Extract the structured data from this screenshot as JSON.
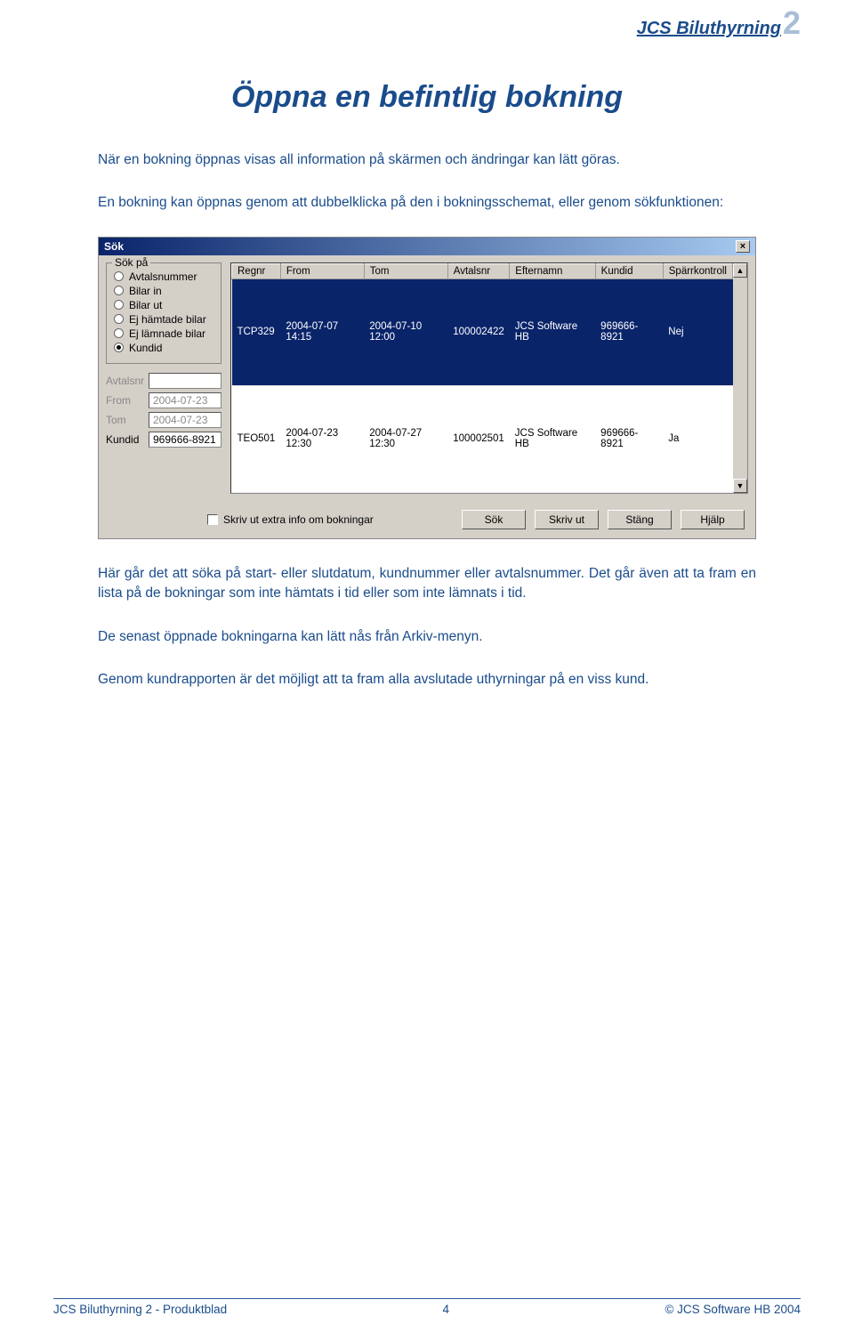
{
  "logo": {
    "text": "JCS Biluthyrning",
    "num": "2"
  },
  "title": "Öppna en befintlig bokning",
  "para1": "När en bokning öppnas visas all information på skärmen och ändringar kan lätt göras.",
  "para2": "En bokning kan öppnas genom att dubbelklicka på den i bokningsschemat, eller genom sökfunktionen:",
  "para3": "Här går det att söka på start- eller slutdatum, kundnummer eller avtalsnummer. Det går även att ta fram en lista på de bokningar som inte hämtats i tid eller som inte lämnats i tid.",
  "para4": "De senast öppnade bokningarna kan lätt nås från Arkiv-menyn.",
  "para5": "Genom kundrapporten är det möjligt att ta fram alla avslutade uthyrningar på en viss kund.",
  "window": {
    "title": "Sök",
    "close": "×",
    "group_label": "Sök på",
    "radios": [
      {
        "label": "Avtalsnummer",
        "checked": false
      },
      {
        "label": "Bilar in",
        "checked": false
      },
      {
        "label": "Bilar ut",
        "checked": false
      },
      {
        "label": "Ej hämtade bilar",
        "checked": false
      },
      {
        "label": "Ej lämnade bilar",
        "checked": false
      },
      {
        "label": "Kundid",
        "checked": true
      }
    ],
    "fields": {
      "avtalsnr": {
        "label": "Avtalsnr",
        "value": ""
      },
      "from": {
        "label": "From",
        "value": "2004-07-23"
      },
      "tom": {
        "label": "Tom",
        "value": "2004-07-23"
      },
      "kundid": {
        "label": "Kundid",
        "value": "969666-8921"
      }
    },
    "columns": [
      "Regnr",
      "From",
      "Tom",
      "Avtalsnr",
      "Efternamn",
      "Kundid",
      "Spärrkontroll"
    ],
    "rows": [
      {
        "cells": [
          "TCP329",
          "2004-07-07 14:15",
          "2004-07-10 12:00",
          "100002422",
          "JCS Software HB",
          "969666-8921",
          "Nej"
        ],
        "selected": true
      },
      {
        "cells": [
          "TEO501",
          "2004-07-23 12:30",
          "2004-07-27 12:30",
          "100002501",
          "JCS Software HB",
          "969666-8921",
          "Ja"
        ],
        "selected": false
      }
    ],
    "scrollbar": {
      "up": "▲",
      "down": "▼"
    },
    "checkbox_label": "Skriv ut extra info om bokningar",
    "buttons": [
      "Sök",
      "Skriv ut",
      "Stäng",
      "Hjälp"
    ]
  },
  "footer": {
    "left": "JCS Biluthyrning 2 - Produktblad",
    "page": "4",
    "right": "© JCS Software HB 2004"
  }
}
